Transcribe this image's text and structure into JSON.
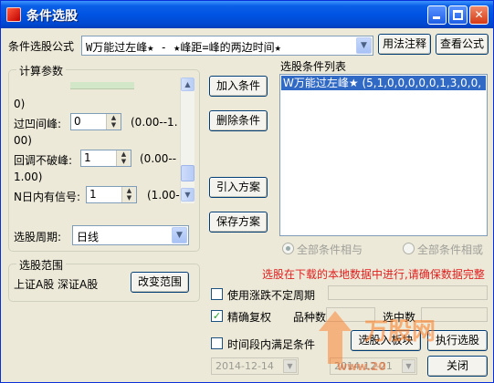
{
  "window": {
    "title": "条件选股",
    "colors": {
      "title_bar": "#0054e3",
      "selection": "#316ac5",
      "warning_text": "#e02020"
    }
  },
  "formula": {
    "label": "条件选股公式",
    "selected": "W万能过左峰★ - ★峰距=峰的两边时间★",
    "usage_button": "用法注释",
    "view_button": "查看公式"
  },
  "params": {
    "group_label": "计算参数",
    "top_partial": "0)",
    "rows": [
      {
        "label": "过凹间峰:",
        "value": "0",
        "range_a": "(0.00--1.",
        "range_b": "00)"
      },
      {
        "label": "回调不破峰:",
        "value": "1",
        "range_a": "(0.00--",
        "range_b": "1.00)"
      },
      {
        "label": "N日内有信号:",
        "value": "1",
        "range_a": "(1.00-",
        "range_b": ""
      }
    ]
  },
  "period": {
    "label": "选股周期:",
    "selected": "日线"
  },
  "actions": {
    "add": "加入条件",
    "remove": "删除条件",
    "import": "引入方案",
    "save": "保存方案"
  },
  "condition_list": {
    "label": "选股条件列表",
    "items": [
      "W万能过左峰★ (5,1,0,0,0,0,0,1,3,0,0,"
    ]
  },
  "logic": {
    "and_label": "全部条件相与",
    "or_label": "全部条件相或"
  },
  "warning": "选股在下载的本地数据中进行,请确保数据完整",
  "range": {
    "group_label": "选股范围",
    "value": "上证A股 深证A股",
    "change_button": "改变范围"
  },
  "options": {
    "use_limit_label": "使用涨跌不定周期",
    "adjust_label": "精确复权",
    "adjust_checked": true,
    "count_label": "品种数",
    "selected_label": "选中数",
    "period_label": "时间段内满足条件",
    "date_from": "2014-12-14",
    "date_to": "2014-12-21"
  },
  "bottom": {
    "add_to_block": "选股入板块",
    "run": "执行选股",
    "close": "关闭"
  },
  "watermark": {
    "brand": "万股网",
    "url": "www.20"
  }
}
